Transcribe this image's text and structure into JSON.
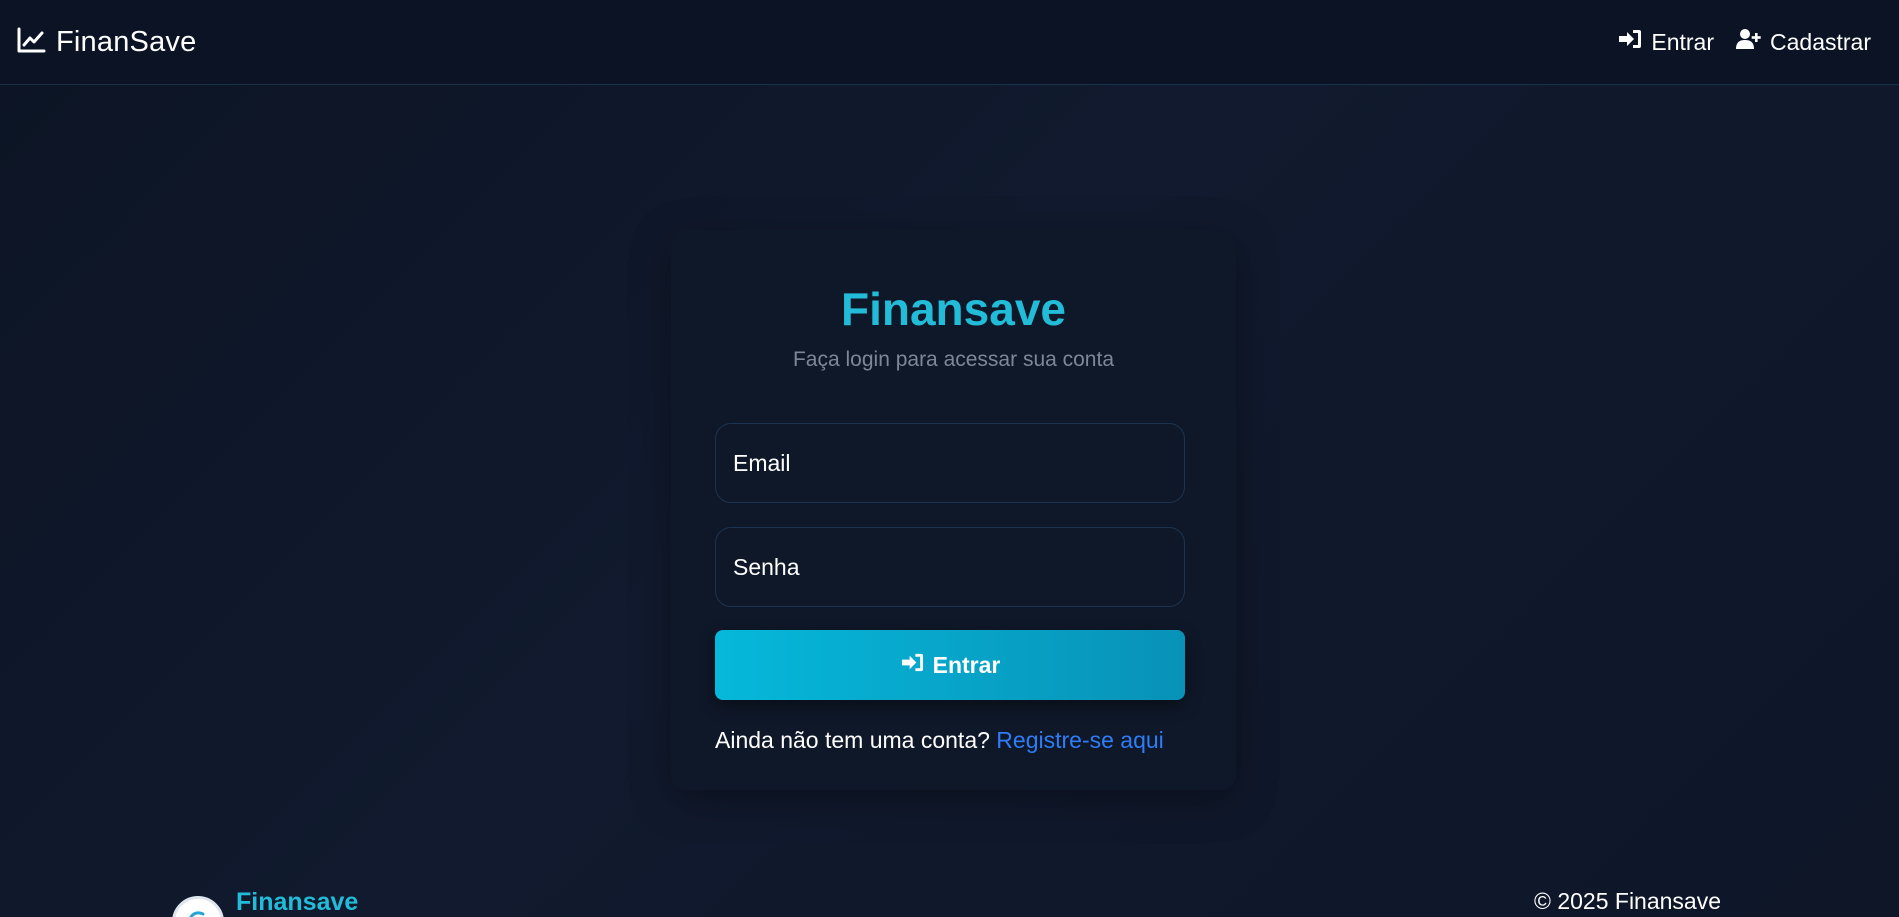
{
  "navbar": {
    "brand": "FinanSave",
    "brand_icon": "chart-line-icon",
    "links": [
      {
        "label": "Entrar",
        "icon": "sign-in-icon"
      },
      {
        "label": "Cadastrar",
        "icon": "user-plus-icon"
      }
    ]
  },
  "login": {
    "title": "Finansave",
    "subtitle": "Faça login para acessar sua conta",
    "email_placeholder": "Email",
    "password_placeholder": "Senha",
    "submit_label": "Entrar",
    "signup_prompt": "Ainda não tem uma conta?",
    "signup_link": "Registre-se aqui"
  },
  "footer": {
    "brand": "Finansave",
    "copyright": "© 2025 Finansave"
  },
  "colors": {
    "accent": "#22bcd9",
    "button": "#06b8da",
    "link": "#2f7cf6",
    "background": "#0d1526"
  }
}
